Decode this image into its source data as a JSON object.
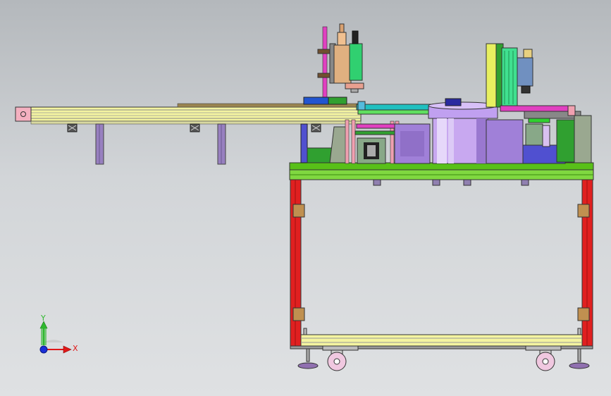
{
  "viewport": {
    "background_top": "#b4b8bc",
    "background_bottom": "#dfe1e3"
  },
  "axis_triad": {
    "y_label": "Y",
    "x_label": "X",
    "y_color": "#2fb82f",
    "x_color": "#e01818",
    "z_color": "#1a2fd8"
  },
  "palette": {
    "frame_red": "#e02020",
    "frame_green": "#58c018",
    "rail_yellow": "#f4f4a0",
    "bowl_violet": "#b890e0",
    "cylinder_tan": "#e0b080",
    "wheel_pink": "#f0c8e0"
  }
}
